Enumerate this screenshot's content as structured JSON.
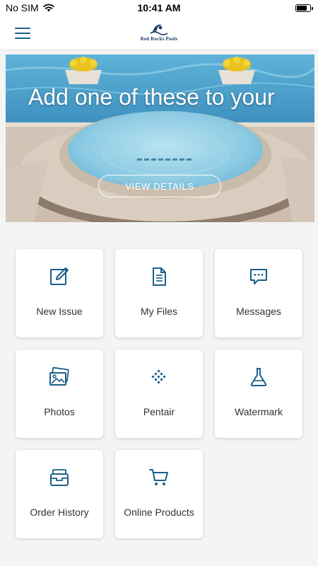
{
  "status_bar": {
    "carrier": "No SIM",
    "time": "10:41 AM",
    "battery_level": 0.85
  },
  "header": {
    "menu_icon": "hamburger-menu-icon",
    "logo_text": "Red Rocks Pools"
  },
  "hero": {
    "title": "Add one of these to your",
    "button_label": "VIEW DETAILS"
  },
  "tiles": [
    {
      "label": "New Issue",
      "icon": "edit-icon"
    },
    {
      "label": "My Files",
      "icon": "document-icon"
    },
    {
      "label": "Messages",
      "icon": "chat-icon"
    },
    {
      "label": "Photos",
      "icon": "photos-icon"
    },
    {
      "label": "Pentair",
      "icon": "pentair-logo-icon"
    },
    {
      "label": "Watermark",
      "icon": "flask-icon"
    },
    {
      "label": "Order History",
      "icon": "archive-box-icon"
    },
    {
      "label": "Online Products",
      "icon": "cart-icon"
    }
  ],
  "colors": {
    "accent": "#1a5f8a",
    "background": "#f4f4f4",
    "tile": "#ffffff"
  }
}
